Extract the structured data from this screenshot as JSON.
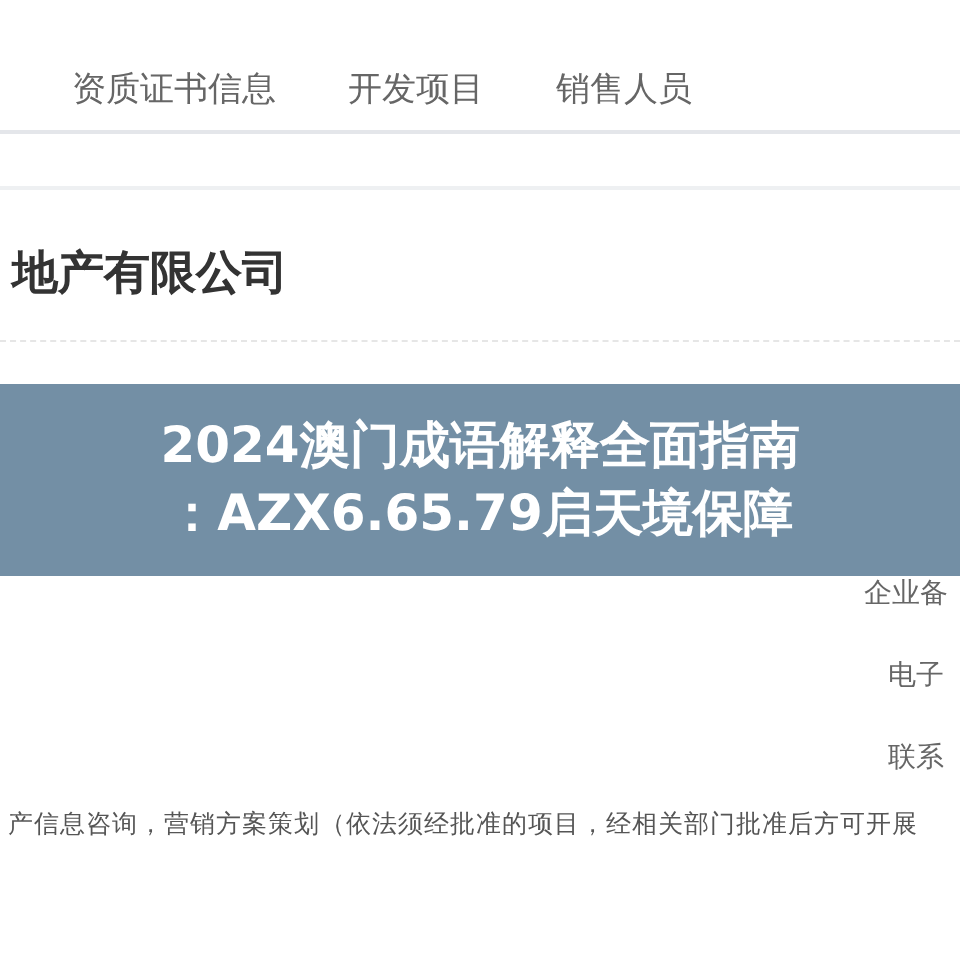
{
  "tabs": [
    {
      "label": "资质证书信息",
      "selected": false
    },
    {
      "label": "开发项目",
      "selected": false
    },
    {
      "label": "销售人员",
      "selected": false
    }
  ],
  "company": {
    "name": "地产有限公司"
  },
  "rows": [
    {
      "label": "企业备"
    },
    {
      "label": "电子"
    },
    {
      "label": "联系"
    }
  ],
  "business_scope": "产信息咨询，营销方案策划（依法须经批准的项目，经相关部门批准后方可开展",
  "banner": {
    "lines": [
      "2024澳门成语解释全面指南",
      "：AZX6.65.79启天境保障"
    ]
  }
}
